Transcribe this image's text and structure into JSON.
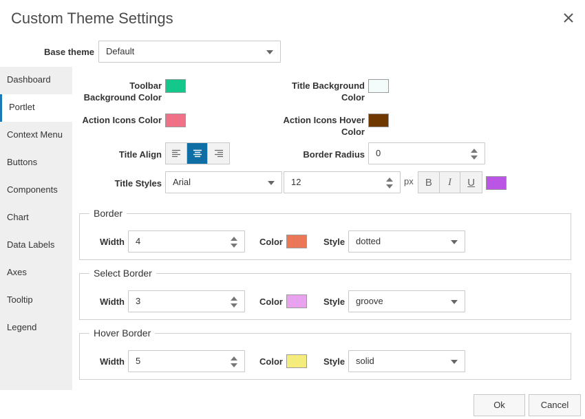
{
  "dialog": {
    "title": "Custom Theme Settings"
  },
  "base_theme": {
    "label": "Base theme",
    "value": "Default"
  },
  "sidebar": {
    "items": [
      {
        "label": "Dashboard"
      },
      {
        "label": "Portlet"
      },
      {
        "label": "Context Menu"
      },
      {
        "label": "Buttons"
      },
      {
        "label": "Components"
      },
      {
        "label": "Chart"
      },
      {
        "label": "Data Labels"
      },
      {
        "label": "Axes"
      },
      {
        "label": "Tooltip"
      },
      {
        "label": "Legend"
      }
    ],
    "active": "Portlet"
  },
  "portlet": {
    "toolbar_bg": {
      "label_line1": "Toolbar",
      "label_line2": "Background Color",
      "color": "#14c88c"
    },
    "title_bg": {
      "label_line1": "Title Background",
      "label_line2": "Color",
      "color": "#f4fbfb"
    },
    "action_icons": {
      "label": "Action Icons Color",
      "color": "#f07088"
    },
    "action_icons_hover": {
      "label_line1": "Action Icons Hover",
      "label_line2": "Color",
      "color": "#6e3800"
    },
    "title_align": {
      "label": "Title Align",
      "options": [
        "left-align-icon",
        "center-align-icon",
        "right-align-icon"
      ],
      "selected": "center"
    },
    "border_radius": {
      "label": "Border Radius",
      "value": "0"
    },
    "title_styles": {
      "label": "Title Styles",
      "font": "Arial",
      "size": "12",
      "unit": "px",
      "bold": "B",
      "italic": "I",
      "underline": "U",
      "color": "#bb55e6"
    }
  },
  "borders": [
    {
      "legend": "Border",
      "width_label": "Width",
      "width": "4",
      "color_label": "Color",
      "color": "#ec7658",
      "style_label": "Style",
      "style": "dotted"
    },
    {
      "legend": "Select Border",
      "width_label": "Width",
      "width": "3",
      "color_label": "Color",
      "color": "#e8a2ee",
      "style_label": "Style",
      "style": "groove"
    },
    {
      "legend": "Hover Border",
      "width_label": "Width",
      "width": "5",
      "color_label": "Color",
      "color": "#f4ec7c",
      "style_label": "Style",
      "style": "solid"
    }
  ],
  "footer": {
    "ok": "Ok",
    "cancel": "Cancel"
  },
  "colors": {
    "accent": "#0f6fa5",
    "active_nav_border": "#1a7ab8"
  }
}
